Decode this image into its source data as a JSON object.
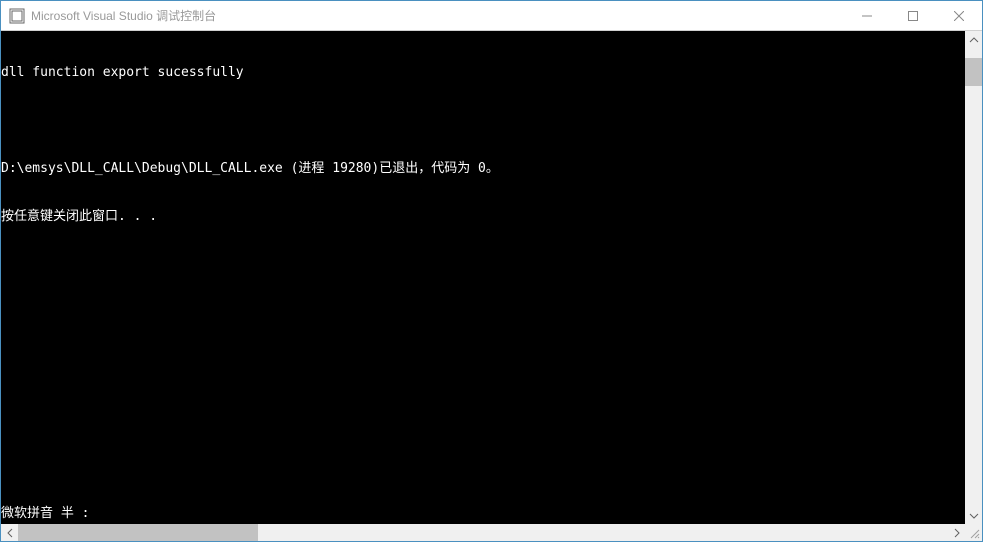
{
  "window": {
    "title": "Microsoft Visual Studio 调试控制台"
  },
  "console": {
    "lines": [
      "dll function export sucessfully",
      "",
      "D:\\emsys\\DLL_CALL\\Debug\\DLL_CALL.exe (进程 19280)已退出，代码为 0。",
      "按任意键关闭此窗口. . ."
    ],
    "ime_status": "微软拼音 半 :"
  }
}
